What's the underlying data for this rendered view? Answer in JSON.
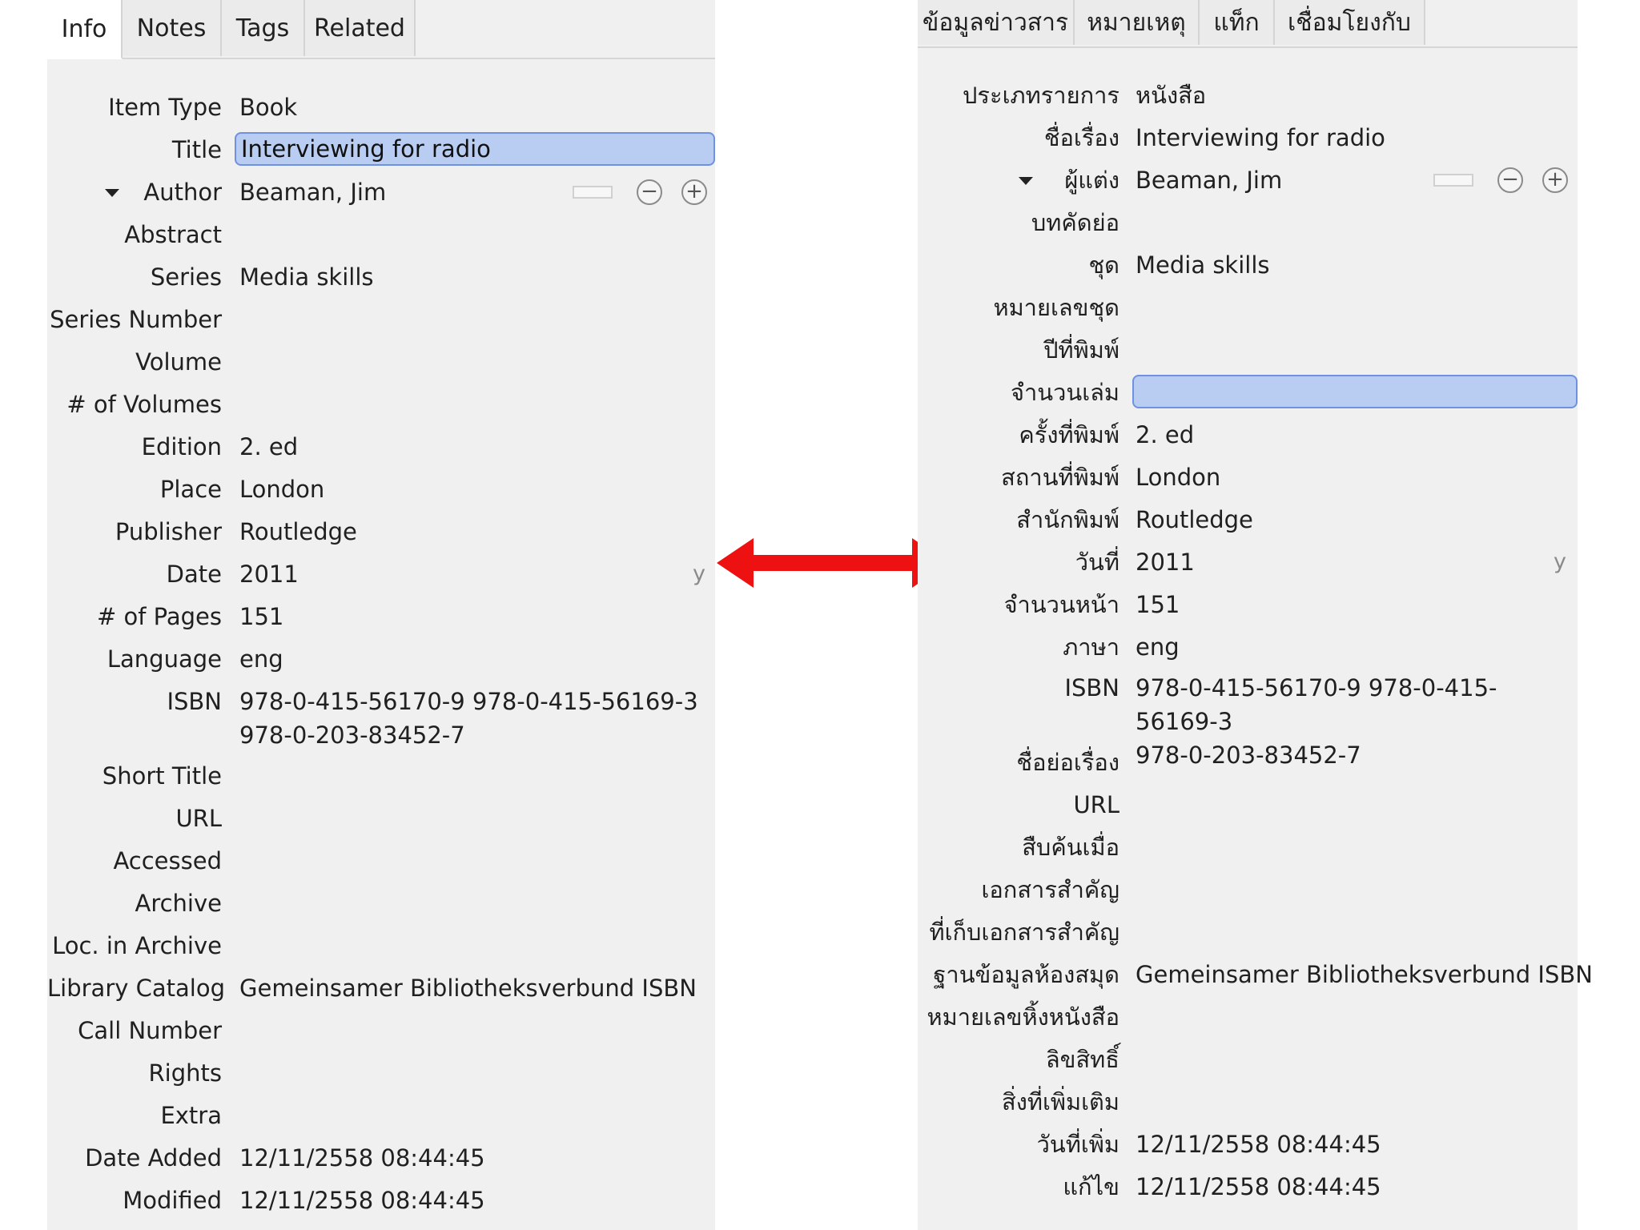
{
  "left": {
    "tabs": [
      "Info",
      "Notes",
      "Tags",
      "Related"
    ],
    "fields": {
      "item_type": {
        "label": "Item Type",
        "value": "Book"
      },
      "title": {
        "label": "Title",
        "value": "Interviewing for radio"
      },
      "author": {
        "label": "Author",
        "value": "Beaman, Jim"
      },
      "abstract": {
        "label": "Abstract",
        "value": ""
      },
      "series": {
        "label": "Series",
        "value": "Media skills"
      },
      "series_number": {
        "label": "Series Number",
        "value": ""
      },
      "volume": {
        "label": "Volume",
        "value": ""
      },
      "num_volumes": {
        "label": "# of Volumes",
        "value": ""
      },
      "edition": {
        "label": "Edition",
        "value": "2. ed"
      },
      "place": {
        "label": "Place",
        "value": "London"
      },
      "publisher": {
        "label": "Publisher",
        "value": "Routledge"
      },
      "date": {
        "label": "Date",
        "value": "2011",
        "hint": "y"
      },
      "num_pages": {
        "label": "# of Pages",
        "value": "151"
      },
      "language": {
        "label": "Language",
        "value": "eng"
      },
      "isbn": {
        "label": "ISBN",
        "value_line1": "978-0-415-56170-9 978-0-415-56169-3",
        "value_line2": "978-0-203-83452-7"
      },
      "short_title": {
        "label": "Short Title",
        "value": ""
      },
      "url": {
        "label": "URL",
        "value": ""
      },
      "accessed": {
        "label": "Accessed",
        "value": ""
      },
      "archive": {
        "label": "Archive",
        "value": ""
      },
      "loc_in_archive": {
        "label": "Loc. in Archive",
        "value": ""
      },
      "library_catalog": {
        "label": "Library Catalog",
        "value": "Gemeinsamer Bibliotheksverbund ISBN"
      },
      "call_number": {
        "label": "Call Number",
        "value": ""
      },
      "rights": {
        "label": "Rights",
        "value": ""
      },
      "extra": {
        "label": "Extra",
        "value": ""
      },
      "date_added": {
        "label": "Date Added",
        "value": "12/11/2558 08:44:45"
      },
      "modified": {
        "label": "Modified",
        "value": "12/11/2558 08:44:45"
      }
    }
  },
  "right": {
    "tabs": [
      "ข้อมูลข่าวสาร",
      "หมายเหตุ",
      "แท็ก",
      "เชื่อมโยงกับ"
    ],
    "fields": {
      "item_type": {
        "label": "ประเภทรายการ",
        "value": "หนังสือ"
      },
      "title": {
        "label": "ชื่อเรื่อง",
        "value": "Interviewing for radio"
      },
      "author": {
        "label": "ผู้แต่ง",
        "value": "Beaman, Jim"
      },
      "abstract": {
        "label": "บทคัดย่อ",
        "value": ""
      },
      "series": {
        "label": "ชุด",
        "value": "Media skills"
      },
      "series_number": {
        "label": "หมายเลขชุด",
        "value": ""
      },
      "volume": {
        "label": "ปีที่พิมพ์",
        "value": ""
      },
      "num_volumes": {
        "label": "จำนวนเล่ม",
        "value": ""
      },
      "edition": {
        "label": "ครั้งที่พิมพ์",
        "value": "2. ed"
      },
      "place": {
        "label": "สถานที่พิมพ์",
        "value": "London"
      },
      "publisher": {
        "label": "สำนักพิมพ์",
        "value": "Routledge"
      },
      "date": {
        "label": "วันที่",
        "value": "2011",
        "hint": "y"
      },
      "num_pages": {
        "label": "จำนวนหน้า",
        "value": "151"
      },
      "language": {
        "label": "ภาษา",
        "value": "eng"
      },
      "isbn": {
        "label": "ISBN",
        "value_line1": "978-0-415-56170-9 978-0-415-56169-3",
        "value_line2": "978-0-203-83452-7"
      },
      "short_title": {
        "label": "ชื่อย่อเรื่อง",
        "value": ""
      },
      "url": {
        "label": "URL",
        "value": ""
      },
      "accessed": {
        "label": "สืบค้นเมื่อ",
        "value": ""
      },
      "archive": {
        "label": "เอกสารสำคัญ",
        "value": ""
      },
      "loc_in_archive": {
        "label": "ที่เก็บเอกสารสำคัญ",
        "value": ""
      },
      "library_catalog": {
        "label": "ฐานข้อมูลห้องสมุด",
        "value": "Gemeinsamer Bibliotheksverbund ISBN"
      },
      "call_number": {
        "label": "หมายเลขหิ้งหนังสือ",
        "value": ""
      },
      "rights": {
        "label": "ลิขสิทธิ์",
        "value": ""
      },
      "extra": {
        "label": "สิ่งที่เพิ่มเติม",
        "value": ""
      },
      "date_added": {
        "label": "วันที่เพิ่ม",
        "value": "12/11/2558 08:44:45"
      },
      "modified": {
        "label": "แก้ไข",
        "value": "12/11/2558 08:44:45"
      }
    }
  },
  "colors": {
    "panel_bg": "#f0f0f0",
    "highlight_fill": "#b9cdf2",
    "highlight_border": "#6f91e0",
    "arrow": "#ee1111"
  }
}
